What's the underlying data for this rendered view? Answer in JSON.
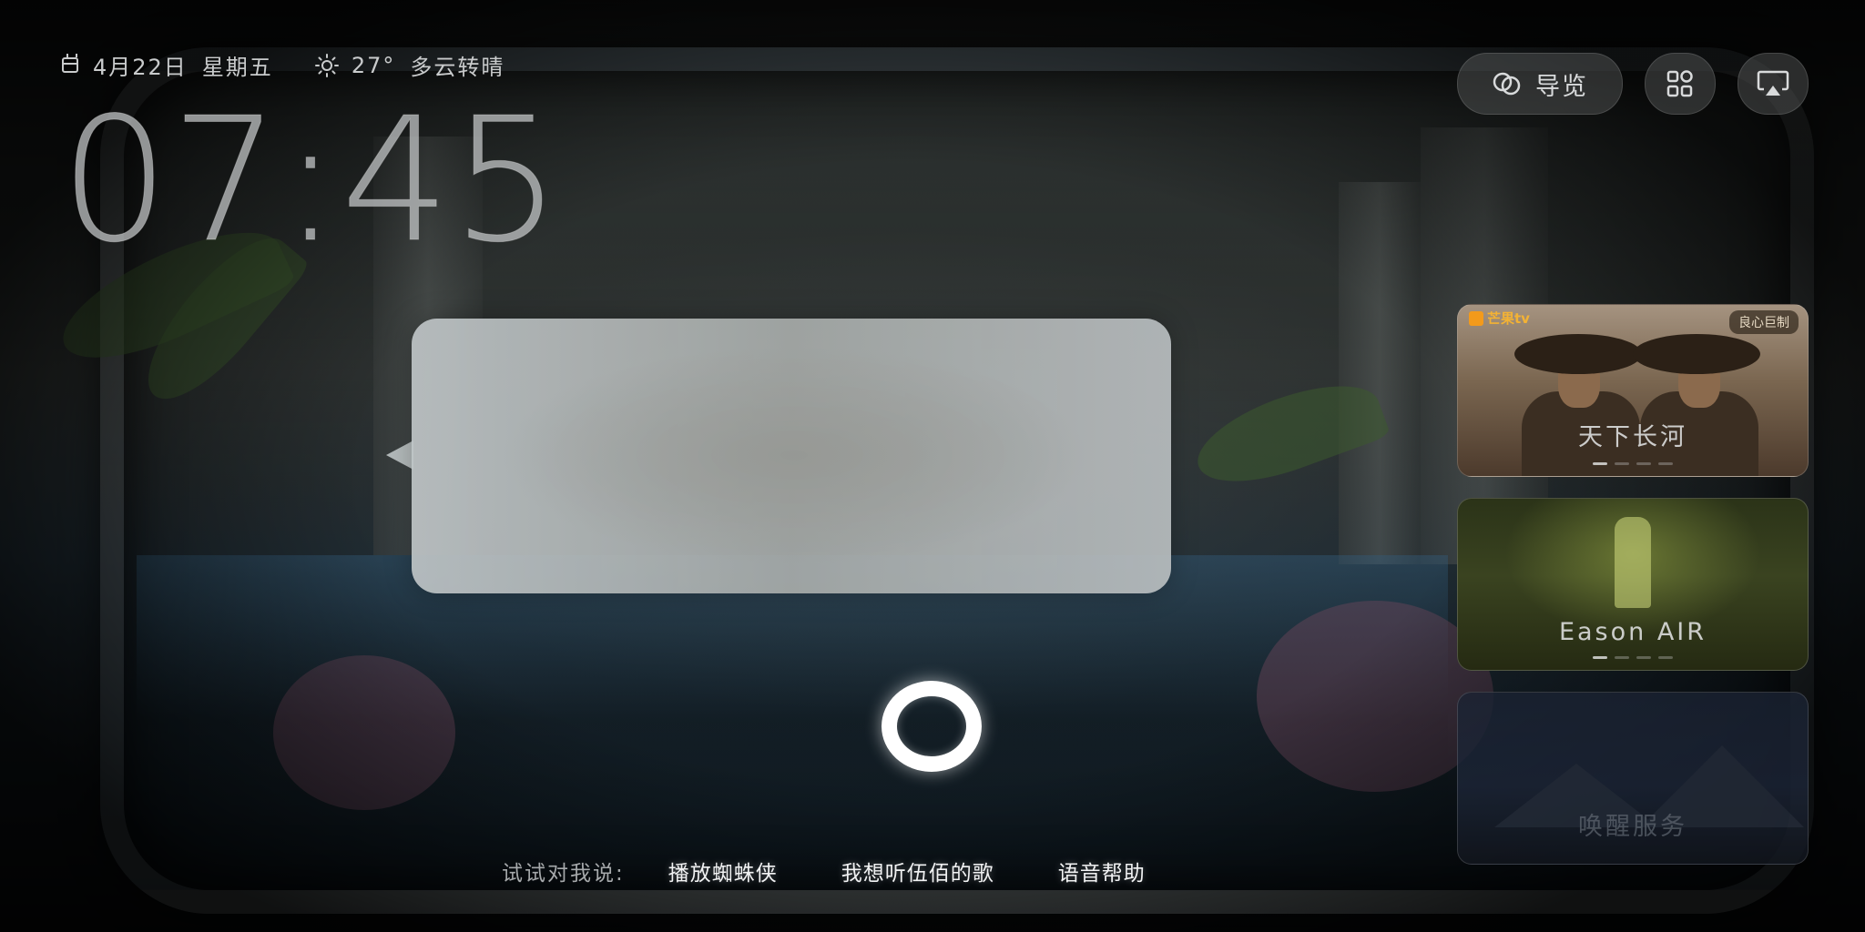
{
  "status": {
    "date": "4月22日",
    "weekday": "星期五",
    "temperature": "27°",
    "weather": "多云转晴"
  },
  "clock": "07:45",
  "top_buttons": {
    "guide_label": "导览"
  },
  "suggestions": {
    "prefix": "试试对我说:",
    "items": [
      "播放蜘蛛侠",
      "我想听伍佰的歌",
      "语音帮助"
    ]
  },
  "cards": [
    {
      "title": "天下长河",
      "brand": "芒果tv",
      "badge": "良心巨制"
    },
    {
      "title": "Eason AIR"
    },
    {
      "title": "唤醒服务"
    }
  ],
  "colors": {
    "accent_brand": "#f39a1b",
    "voice_ring": "#ffffff"
  },
  "icons": [
    "calendar-icon",
    "sun-icon",
    "guide-icon",
    "apps-grid-icon",
    "cast-icon"
  ]
}
